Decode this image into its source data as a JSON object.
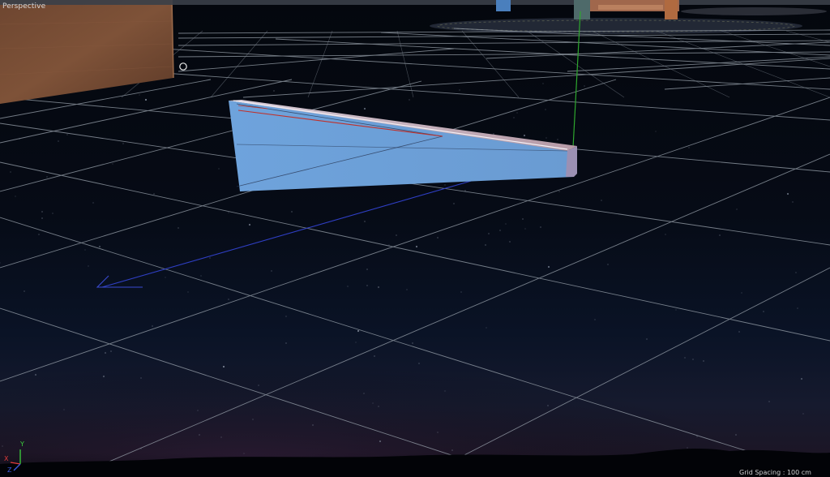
{
  "viewport": {
    "view_name": "Perspective",
    "grid_spacing_text": "Grid Spacing : 100 cm"
  },
  "gizmo": {
    "axis_y": "Y",
    "axis_x": "X",
    "axis_z": "Z",
    "color_y": "#3cd23c",
    "color_x": "#e03c3c",
    "color_z": "#3c5ae0"
  },
  "colors": {
    "object_face": "#6fa3da",
    "object_top": "#c9b6bf",
    "object_end": "#9a93b8",
    "grid_line": "#9aa3ad",
    "y_axis_line": "#2ea82e",
    "z_axis_line": "#2f3fc4",
    "selection_outline": "#c0302a"
  },
  "icons": {
    "cursor": "circle-cursor-icon"
  }
}
